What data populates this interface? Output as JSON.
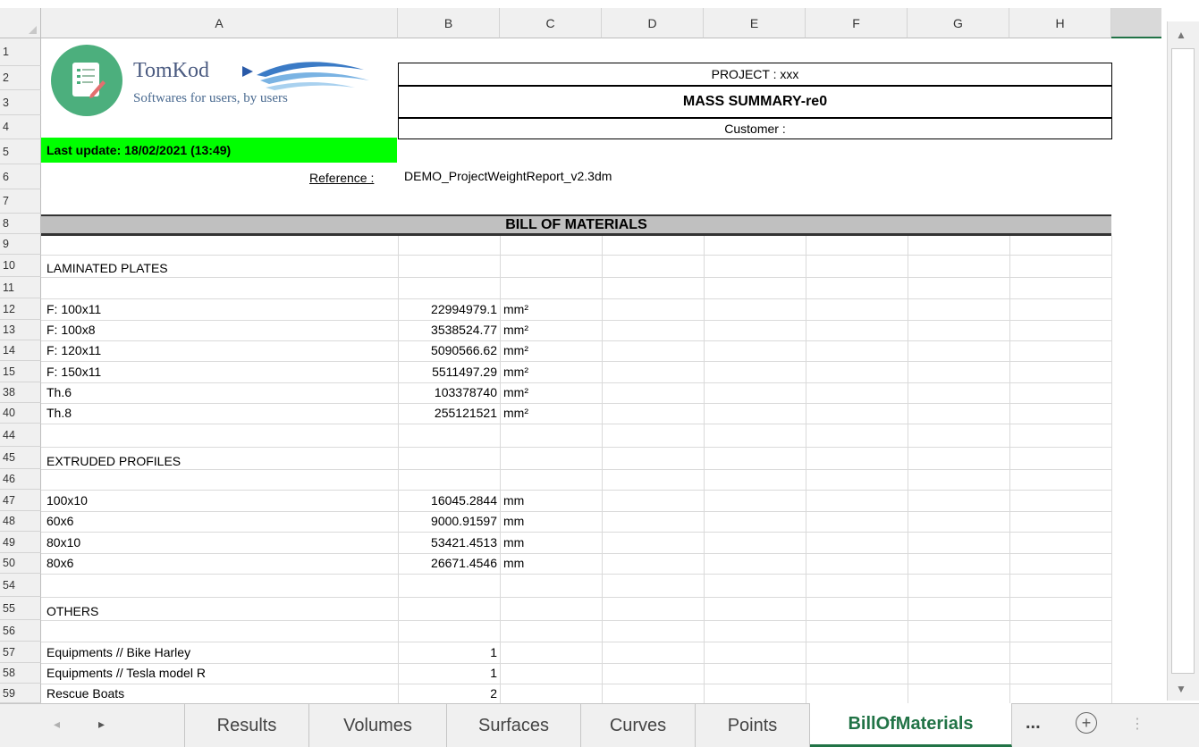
{
  "columns": [
    "A",
    "B",
    "C",
    "D",
    "E",
    "F",
    "G",
    "H"
  ],
  "rows": [
    "1",
    "2",
    "3",
    "4",
    "5",
    "6",
    "7",
    "8",
    "9",
    "10",
    "11",
    "12",
    "13",
    "14",
    "15",
    "38",
    "40",
    "44",
    "45",
    "46",
    "47",
    "48",
    "49",
    "50",
    "54",
    "55",
    "56",
    "57",
    "58",
    "59"
  ],
  "logo": {
    "name": "TomKod",
    "tagline": "Softwares for users, by users"
  },
  "header": {
    "project": "PROJECT : xxx",
    "title": "MASS SUMMARY-re0",
    "customer": "Customer :"
  },
  "last_update": "Last update:  18/02/2021 (13:49)",
  "reference": {
    "label": "Reference :",
    "value": "DEMO_ProjectWeightReport_v2.3dm"
  },
  "bom_title": "BILL OF MATERIALS",
  "sections": {
    "laminated": "LAMINATED PLATES",
    "extruded": "EXTRUDED PROFILES",
    "others": "OTHERS"
  },
  "laminated_items": [
    {
      "name": "F: 100x11",
      "value": "22994979.1",
      "unit": "mm²"
    },
    {
      "name": "F: 100x8",
      "value": "3538524.77",
      "unit": "mm²"
    },
    {
      "name": "F: 120x11",
      "value": "5090566.62",
      "unit": "mm²"
    },
    {
      "name": "F: 150x11",
      "value": "5511497.29",
      "unit": "mm²"
    },
    {
      "name": "Th.6",
      "value": "103378740",
      "unit": "mm²"
    },
    {
      "name": "Th.8",
      "value": "255121521",
      "unit": "mm²"
    }
  ],
  "extruded_items": [
    {
      "name": "100x10",
      "value": "16045.2844",
      "unit": "mm"
    },
    {
      "name": "60x6",
      "value": "9000.91597",
      "unit": "mm"
    },
    {
      "name": "80x10",
      "value": "53421.4513",
      "unit": "mm"
    },
    {
      "name": "80x6",
      "value": "26671.4546",
      "unit": "mm"
    }
  ],
  "other_items": [
    {
      "name": "Equipments // Bike Harley",
      "value": "1"
    },
    {
      "name": "Equipments // Tesla model R",
      "value": "1"
    },
    {
      "name": "Rescue Boats",
      "value": "2"
    }
  ],
  "tabs": [
    "Results",
    "Volumes",
    "Surfaces",
    "Curves",
    "Points",
    "BillOfMaterials"
  ],
  "tabs_more": "...",
  "tabs_add": "+",
  "active_tab": "BillOfMaterials"
}
